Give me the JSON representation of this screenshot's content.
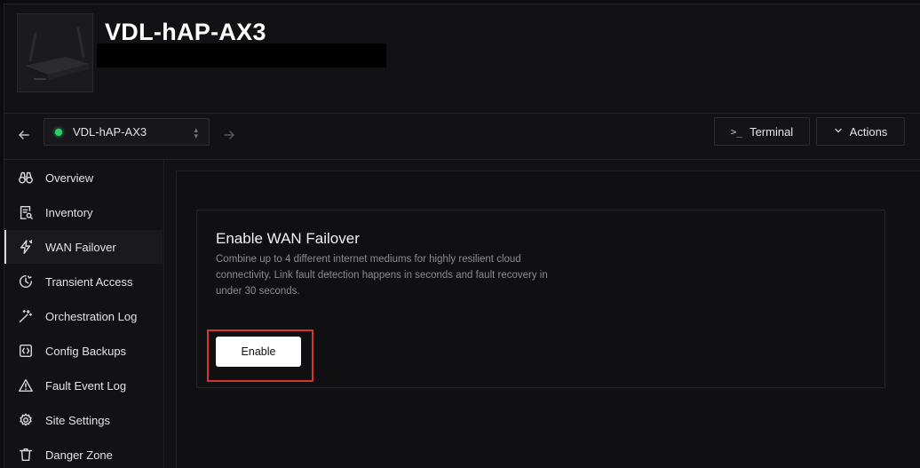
{
  "header": {
    "device_title": "VDL-hAP-AX3"
  },
  "toolbar": {
    "back_icon": "arrow-left-icon",
    "forward_icon": "arrow-right-icon",
    "device_select_value": "VDL-hAP-AX3",
    "status_color": "#2ed06a",
    "terminal_label": "Terminal",
    "terminal_icon_text": ">_",
    "actions_label": "Actions",
    "actions_icon": "chevron-down-icon"
  },
  "sidebar": {
    "items": [
      {
        "label": "Overview",
        "icon": "binoculars-icon"
      },
      {
        "label": "Inventory",
        "icon": "document-search-icon"
      },
      {
        "label": "WAN Failover",
        "icon": "lightning-icon",
        "active": true
      },
      {
        "label": "Transient Access",
        "icon": "clock-icon"
      },
      {
        "label": "Orchestration Log",
        "icon": "magic-wand-icon"
      },
      {
        "label": "Config Backups",
        "icon": "code-brackets-icon"
      },
      {
        "label": "Fault Event Log",
        "icon": "warning-icon"
      },
      {
        "label": "Site Settings",
        "icon": "gear-icon"
      },
      {
        "label": "Danger Zone",
        "icon": "trash-icon"
      }
    ]
  },
  "main": {
    "card_title": "Enable WAN Failover",
    "card_description": "Combine up to 4 different internet mediums for highly resilient cloud connectivity. Link fault detection happens in seconds and fault recovery in under 30 seconds.",
    "enable_label": "Enable",
    "highlight_color": "#d2362e"
  }
}
